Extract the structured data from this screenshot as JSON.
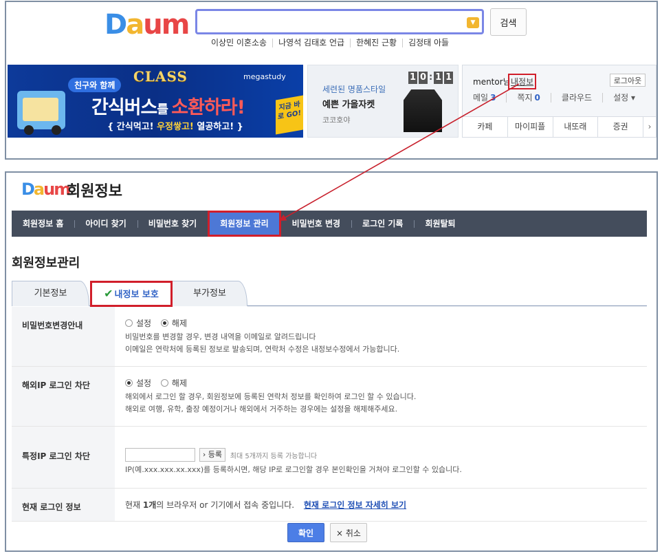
{
  "top": {
    "logo": [
      "D",
      "a",
      "u",
      "m"
    ],
    "search": {
      "value": "",
      "button_label": "검색"
    },
    "trending": [
      "이상민 이혼소송",
      "나영석 김태호 언급",
      "한혜진 근황",
      "김정태 아들"
    ],
    "banner1": {
      "pill": "친구와 함께",
      "league": "CLASS",
      "brand": "megastudy",
      "main_a": "간식버스",
      "main_b": "를 ",
      "main_c": "소환하라!",
      "sub_a": "{ 간식먹고! ",
      "sub_b": "우정쌓고!",
      "sub_c": " 열공하고! }",
      "tag": "지금 바로 GO!"
    },
    "banner2": {
      "line1": "세련된 명품스타일",
      "line2": "예쁜 가을자켓",
      "line3": "코코호야",
      "clock": [
        "1",
        "0",
        "1",
        "1"
      ]
    },
    "user": {
      "name": "mentor님",
      "myinfo": "내정보",
      "logout": "로그아웃",
      "mail_label": "메일",
      "mail_count": "3",
      "note_label": "쪽지",
      "note_count": "0",
      "cloud": "클라우드",
      "settings": "설정",
      "tabs": [
        "카페",
        "마이피플",
        "내또래",
        "증권"
      ]
    }
  },
  "account": {
    "title": "회원정보",
    "nav": [
      "회원정보 홈",
      "아이디 찾기",
      "비밀번호 찾기",
      "회원정보 관리",
      "비밀번호 변경",
      "로그인 기록",
      "회원탈퇴"
    ],
    "section_title": "회원정보관리",
    "tabs": [
      "기본정보",
      "내정보 보호",
      "부가정보"
    ],
    "rows": {
      "pw": {
        "label": "비밀번호변경안내",
        "on": "설정",
        "off": "해제",
        "desc1": "비밀번호를 변경할 경우, 변경 내역을 이메일로 알려드립니다",
        "desc2": "이메일은 연락처에 등록된 정보로 발송되며, 연락처 수정은 내정보수정에서 가능합니다."
      },
      "foreign": {
        "label": "해외IP 로그인 차단",
        "on": "설정",
        "off": "해제",
        "desc1": "해외에서 로그인 할 경우, 회원정보에 등록된 연락처 정보를 확인하여 로그인 할 수 있습니다.",
        "desc2": "해외로 여행, 유학, 출장 예정이거나 해외에서 거주하는 경우에는 설정을 해제해주세요."
      },
      "ip": {
        "label": "특정IP 로그인 차단",
        "input_value": "",
        "register": "› 등록",
        "note": "최대 5개까지 등록 가능합니다",
        "desc": "IP(예.xxx.xxx.xx.xxx)를 등록하시면, 해당 IP로 로그인할 경우 본인확인을 거쳐야 로그인할 수 있습니다."
      },
      "current": {
        "label": "현재 로그인 정보",
        "text_a": "현재 ",
        "text_b": "1개",
        "text_c": "의 브라우저 or 기기에서 접속 중입니다.",
        "link": "현재 로그인 정보 자세히 보기"
      }
    },
    "buttons": {
      "ok": "확인",
      "cancel": "× 취소"
    }
  },
  "colors": {
    "logo": [
      "#3a8ee6",
      "#f2b630",
      "#e84646",
      "#3a8ee6"
    ],
    "highlight": "#d11e2a",
    "nav_bg": "#444d5c",
    "accent": "#4d78d6"
  }
}
